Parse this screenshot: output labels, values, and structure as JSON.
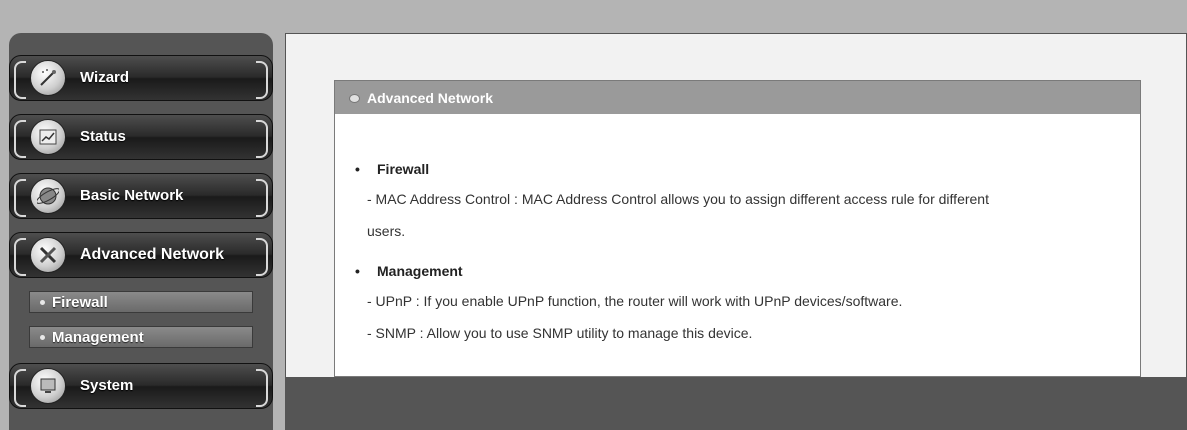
{
  "sidebar": {
    "menu": [
      {
        "label": "Wizard",
        "icon": "wizard-wand-icon"
      },
      {
        "label": "Status",
        "icon": "status-chart-icon"
      },
      {
        "label": "Basic Network",
        "icon": "globe-icon"
      },
      {
        "label": "Advanced Network",
        "icon": "tools-icon"
      },
      {
        "label": "System",
        "icon": "system-monitor-icon"
      }
    ],
    "sub_items": [
      {
        "label": "Firewall"
      },
      {
        "label": "Management"
      }
    ]
  },
  "panel": {
    "title": "Advanced Network",
    "sections": [
      {
        "heading": "Firewall",
        "lines": [
          "- MAC Address Control : MAC Address Control allows you to assign different access rule for different",
          "users."
        ]
      },
      {
        "heading": "Management",
        "lines": [
          "- UPnP : If you enable UPnP function, the router will work with UPnP devices/software.",
          "- SNMP : Allow you to use SNMP utility to manage this device."
        ]
      }
    ]
  }
}
